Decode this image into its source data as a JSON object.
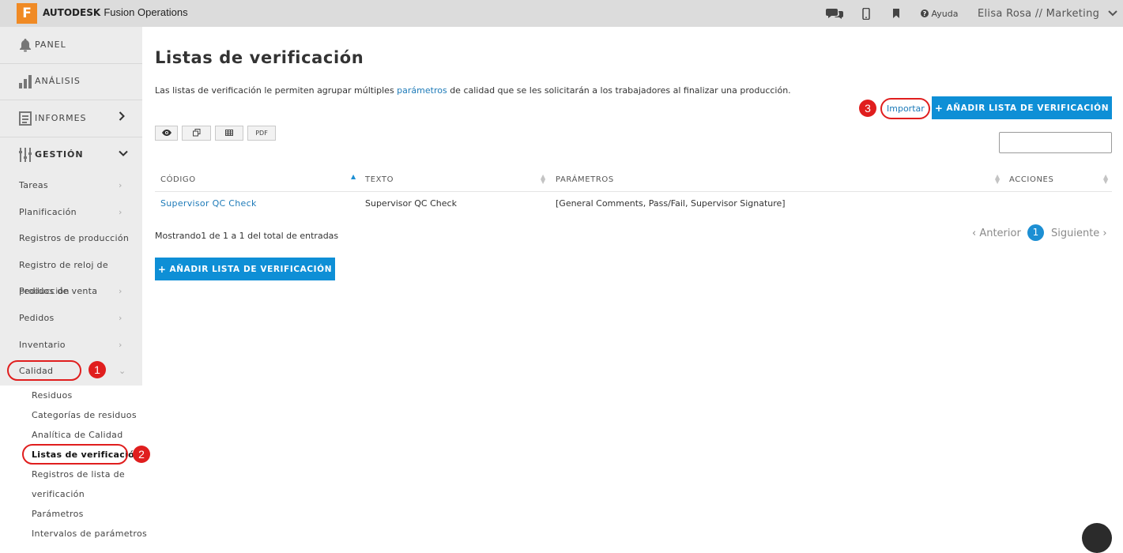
{
  "topbar": {
    "logo_letter": "F",
    "brand_bold": "AUTODESK",
    "brand_app": "Fusion Operations",
    "icons": [
      "chat-icon",
      "mobile-icon",
      "bookmark-icon",
      "help-circle-icon",
      "chevron-down-icon"
    ],
    "help_label": "Ayuda",
    "user_label": "Elisa Rosa // Marketing"
  },
  "sidebar": {
    "panel": "PANEL",
    "analisis": "ANÁLISIS",
    "informes": "INFORMES",
    "gestion": "GESTIÓN",
    "items": [
      {
        "label": "Tareas"
      },
      {
        "label": "Planificación"
      },
      {
        "label": "Registros de producción"
      },
      {
        "label": "Registro de reloj de"
      },
      {
        "label": "Pedidos de venta"
      },
      {
        "label": "Pedidos"
      },
      {
        "label": "Inventario"
      },
      {
        "label": "Calidad"
      }
    ],
    "overlap_text": "producción",
    "sub_items": [
      {
        "label": "Residuos"
      },
      {
        "label": "Categorías de residuos"
      },
      {
        "label": "Analítica de Calidad"
      },
      {
        "label": "Listas de verificación"
      },
      {
        "label": "Registros de lista de"
      },
      {
        "label": "verificación"
      },
      {
        "label": "Parámetros"
      },
      {
        "label": "Intervalos de parámetros"
      }
    ]
  },
  "annotations": {
    "b1": "1",
    "b2": "2",
    "b3": "3",
    "color": "#e01e1e"
  },
  "main": {
    "title": "Listas de verificación",
    "desc_before": "Las listas de verificación le permiten agrupar múltiples ",
    "desc_link": "parámetros",
    "desc_after": " de calidad que se les solicitarán a los trabajadores al finalizar una producción.",
    "import_label": "Importar",
    "add_label": "AÑADIR LISTA DE VERIFICACIÓN",
    "pdf_label": "PDF",
    "search_value": "",
    "columns": [
      "CÓDIGO",
      "TEXTO",
      "PARÁMETROS",
      "ACCIONES"
    ],
    "rows": [
      {
        "codigo": "Supervisor QC Check",
        "texto": "Supervisor QC Check",
        "parametros": "[General Comments, Pass/Fail, Supervisor Signature]"
      }
    ],
    "info": "Mostrando1 de 1 a 1 del total de entradas",
    "prev": "‹ Anterior",
    "page": "1",
    "next": "Siguiente ›",
    "accent": "#0e8fd6",
    "link_color": "#1d7ab8"
  }
}
